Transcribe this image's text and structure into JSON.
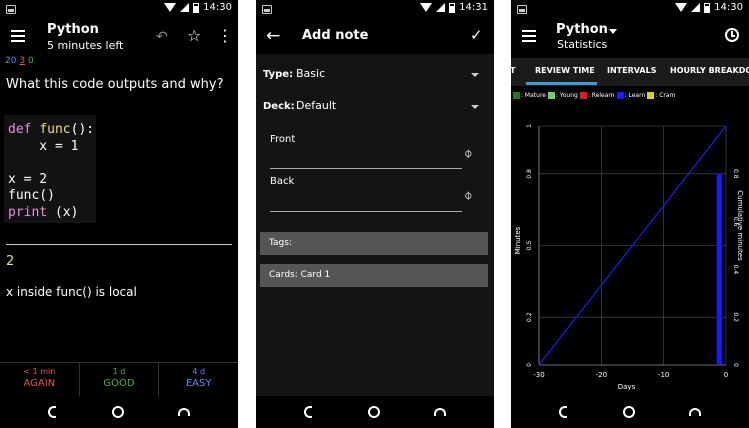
{
  "status": {
    "time1": "14:30",
    "time2": "14:31",
    "time3": "14:30"
  },
  "reviewer": {
    "title": "Python",
    "subtitle": "5 minutes left",
    "counts": {
      "new": "20",
      "learning": "3",
      "review": "0"
    },
    "question": "What this code outputs and why?",
    "code": {
      "line1_kw": "def",
      "line1_fn": "func",
      "line1_rest": "():",
      "line2": "    x = 1",
      "line3": "x = 2",
      "line4": "func()",
      "line5_fn": "print",
      "line5_rest": " (x)"
    },
    "answer": "2",
    "explanation": "x inside func() is local",
    "buttons": [
      {
        "time": "< 1 min",
        "label": "AGAIN"
      },
      {
        "time": "1 d",
        "label": "GOOD"
      },
      {
        "time": "4 d",
        "label": "EASY"
      }
    ],
    "colors": {
      "again": "#e35353",
      "good": "#4caf50",
      "easy": "#5b8cf2"
    }
  },
  "add_note": {
    "title": "Add note",
    "type_label": "Type:",
    "type_value": "Basic",
    "deck_label": "Deck:",
    "deck_value": "Default",
    "front_label": "Front",
    "back_label": "Back",
    "tags_label": "Tags:",
    "cards_label": "Cards: Card 1"
  },
  "stats": {
    "title": "Python",
    "subtitle": "Statistics",
    "tabs": [
      "T",
      "REVIEW TIME",
      "INTERVALS",
      "HOURLY BREAKDOWN"
    ],
    "legend": [
      {
        "label": ": Mature",
        "color": "#1f7a1f"
      },
      {
        "label": ": Young",
        "color": "#6fcf6f"
      },
      {
        "label": ": Relearn",
        "color": "#e31919"
      },
      {
        "label": ": Learn",
        "color": "#1a1aff"
      },
      {
        "label": ": Cram",
        "color": "#d6d619"
      }
    ],
    "accent": "#3a9cd8"
  },
  "chart_data": {
    "type": "bar",
    "xlabel": "Days",
    "ylabel": "Minutes",
    "y2label": "Cumulative minutes",
    "xlim": [
      -30,
      0
    ],
    "ylim": [
      0,
      1
    ],
    "x_ticks": [
      "-30",
      "-20",
      "-10",
      "0"
    ],
    "y_ticks": [
      "0",
      "0.2",
      "0.5",
      "0.8",
      "1"
    ],
    "y2_ticks": [
      "0",
      "0.2",
      "0.4",
      "0.6",
      "0.8"
    ],
    "series": [
      {
        "name": "Learn",
        "type": "bar",
        "x": [
          -1
        ],
        "values": [
          0.8
        ],
        "color": "#1a1aff"
      },
      {
        "type": "line",
        "x": [
          -30,
          0
        ],
        "values": [
          0,
          1
        ],
        "color": "#1a1aff"
      }
    ]
  }
}
